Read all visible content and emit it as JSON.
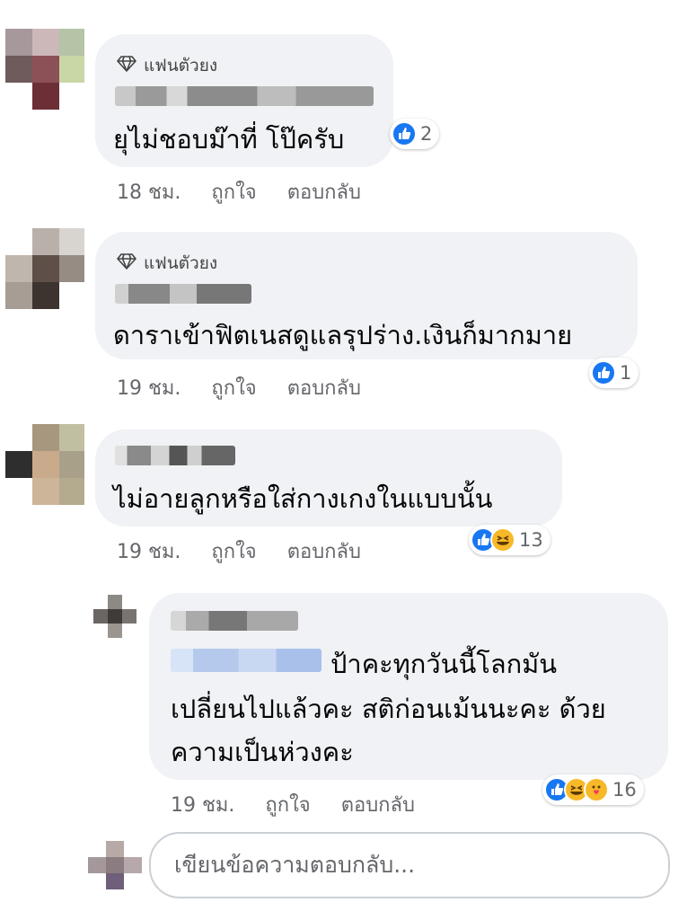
{
  "colors": {
    "bubble": "#f0f2f5",
    "meta_text": "#65676b",
    "like_blue": "#1877f2",
    "haha_yellow": "#f7b928"
  },
  "badge_label": "แฟนตัวยง",
  "comments": [
    {
      "badge": "แฟนตัวยง",
      "text": "ยุไม่ชอบม๊าที่ โป๊ครับ",
      "time": "18 ชม.",
      "like_label": "ถูกใจ",
      "reply_label": "ตอบกลับ",
      "reaction_icons": [
        "like-icon"
      ],
      "reaction_count": "2"
    },
    {
      "badge": "แฟนตัวยง",
      "text": "ดาราเข้าฟิตเนสดูแลรุปร่าง.เงินก็มากมาย",
      "time": "19 ชม.",
      "like_label": "ถูกใจ",
      "reply_label": "ตอบกลับ",
      "reaction_icons": [
        "like-icon"
      ],
      "reaction_count": "1"
    },
    {
      "text": "ไม่อายลูกหรือใส่กางเกงในแบบนั้น",
      "time": "19 ชม.",
      "like_label": "ถูกใจ",
      "reply_label": "ตอบกลับ",
      "reaction_icons": [
        "like-icon",
        "haha-icon"
      ],
      "reaction_count": "13"
    },
    {
      "text_line1": "ป้าคะทุกวันนี้โลกมัน",
      "text_line2": "เปลี่ยนไปแล้วคะ สติก่อนเม้นนะคะ ด้วย",
      "text_line3": "ความเป็นห่วงคะ",
      "time": "19 ชม.",
      "like_label": "ถูกใจ",
      "reply_label": "ตอบกลับ",
      "reaction_icons": [
        "like-icon",
        "haha-icon",
        "care-icon"
      ],
      "reaction_count": "16"
    }
  ],
  "reply_box": {
    "placeholder": "เขียนข้อความตอบกลับ..."
  }
}
